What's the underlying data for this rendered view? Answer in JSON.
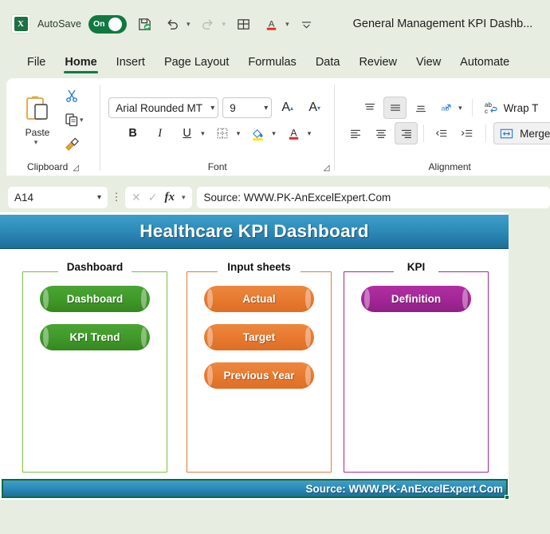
{
  "titlebar": {
    "logo_text": "X",
    "autosave_label": "AutoSave",
    "autosave_state": "On",
    "document_title": "General Management KPI Dashb...",
    "icons": [
      "excel-logo",
      "autosave-toggle",
      "save-icon",
      "undo-icon",
      "redo-icon",
      "table-icon",
      "font-color-icon",
      "customize-quick-access-icon"
    ]
  },
  "tabs": [
    {
      "label": "File",
      "active": false
    },
    {
      "label": "Home",
      "active": true
    },
    {
      "label": "Insert",
      "active": false
    },
    {
      "label": "Page Layout",
      "active": false
    },
    {
      "label": "Formulas",
      "active": false
    },
    {
      "label": "Data",
      "active": false
    },
    {
      "label": "Review",
      "active": false
    },
    {
      "label": "View",
      "active": false
    },
    {
      "label": "Automate",
      "active": false
    }
  ],
  "ribbon": {
    "clipboard": {
      "group_label": "Clipboard",
      "paste_label": "Paste",
      "cut_label": "Cut",
      "copy_label": "Copy",
      "format_painter_label": "Format Painter"
    },
    "font": {
      "group_label": "Font",
      "font_name": "Arial Rounded MT",
      "font_size": "9",
      "bold": "B",
      "italic": "I",
      "underline": "U",
      "grow_font": "A",
      "shrink_font": "A"
    },
    "alignment": {
      "group_label": "Alignment",
      "wrap_text_label": "Wrap T",
      "merge_label": "Merge"
    }
  },
  "formula_bar": {
    "name_box": "A14",
    "fx_label": "fx",
    "formula_value": "Source: WWW.PK-AnExcelExpert.Com"
  },
  "dashboard": {
    "banner_title": "Healthcare KPI Dashboard",
    "banner_color_top": "#3f9fc9",
    "banner_color_bottom": "#1d6e99",
    "groups": [
      {
        "label": "Dashboard",
        "color": "#7ec142",
        "buttons": [
          {
            "label": "Dashboard",
            "color": "#3f9a2a"
          },
          {
            "label": "KPI Trend",
            "color": "#3f9a2a"
          }
        ]
      },
      {
        "label": "Input sheets",
        "color": "#e07b39",
        "buttons": [
          {
            "label": "Actual",
            "color": "#e87a2f"
          },
          {
            "label": "Target",
            "color": "#e87a2f"
          },
          {
            "label": "Previous Year",
            "color": "#e87a2f"
          }
        ]
      },
      {
        "label": "KPI",
        "color": "#a32796",
        "buttons": [
          {
            "label": "Definition",
            "color": "#a32796"
          }
        ]
      }
    ],
    "source_text": "Source: WWW.PK-AnExcelExpert.Com"
  }
}
